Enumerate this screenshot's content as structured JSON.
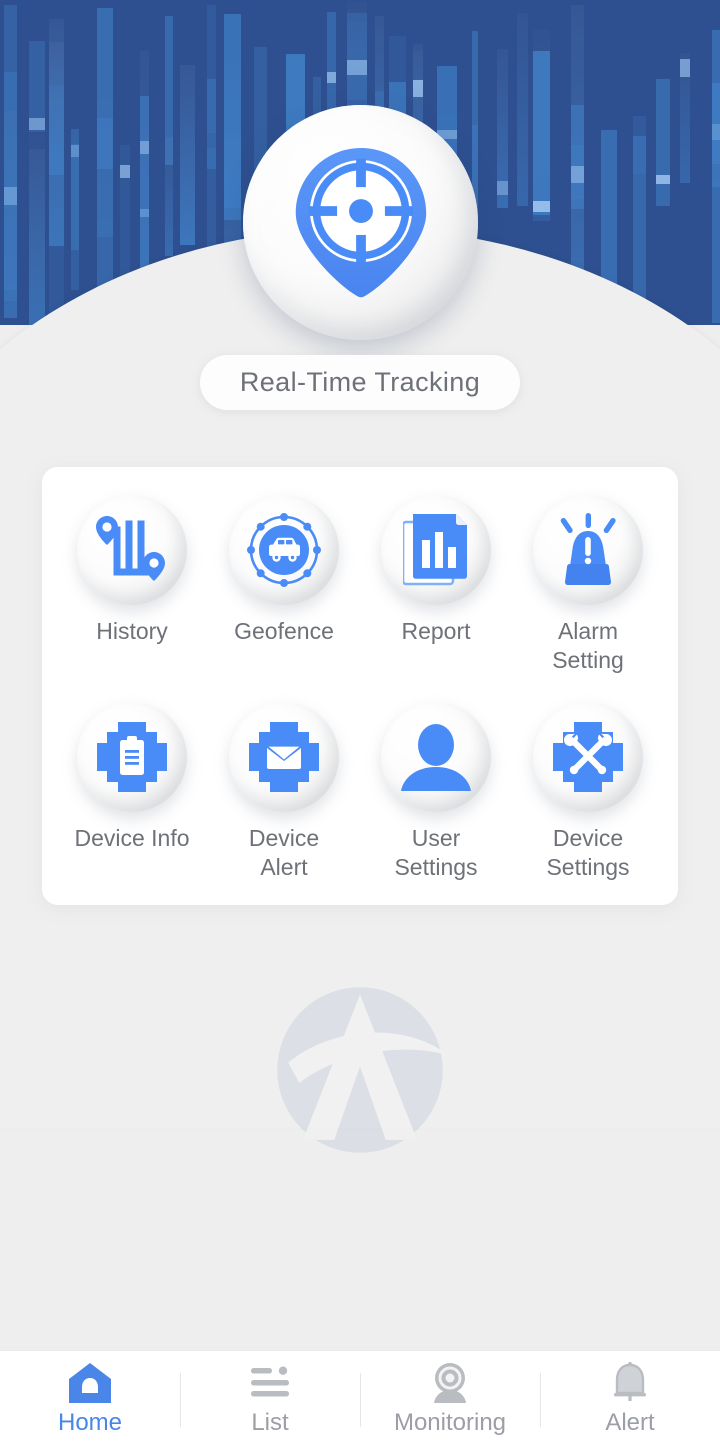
{
  "app": {
    "title": "Real-Time Tracking",
    "brand_watermark": "logo-a-watermark",
    "hero_icon": "target-map-pin-icon",
    "colors": {
      "accent_blue": "#4a8cf7",
      "header_blue_base": "#2e5090",
      "header_bar_blue": "#3f7dc4",
      "label_gray": "#6e7278",
      "nav_inactive_gray": "#9b9fa5",
      "nav_active_blue": "#4a86e8",
      "card_white": "#ffffff",
      "page_background": "#efefef"
    }
  },
  "menu": {
    "items": [
      {
        "label": "History",
        "icon": "route-history-pins-icon"
      },
      {
        "label": "Geofence",
        "icon": "geofence-car-circle-icon"
      },
      {
        "label": "Report",
        "icon": "report-barchart-document-icon"
      },
      {
        "label": "Alarm\nSetting",
        "icon": "alarm-siren-icon"
      },
      {
        "label": "Device Info",
        "icon": "gear-clipboard-icon"
      },
      {
        "label": "Device\nAlert",
        "icon": "gear-envelope-icon"
      },
      {
        "label": "User\nSettings",
        "icon": "user-person-icon"
      },
      {
        "label": "Device\nSettings",
        "icon": "gear-wrenches-icon"
      }
    ]
  },
  "bottom_nav": {
    "items": [
      {
        "label": "Home",
        "icon": "home-house-icon",
        "active": true
      },
      {
        "label": "List",
        "icon": "list-lines-icon",
        "active": false
      },
      {
        "label": "Monitoring",
        "icon": "monitoring-camera-icon",
        "active": false
      },
      {
        "label": "Alert",
        "icon": "alert-bell-icon",
        "active": false
      }
    ]
  }
}
